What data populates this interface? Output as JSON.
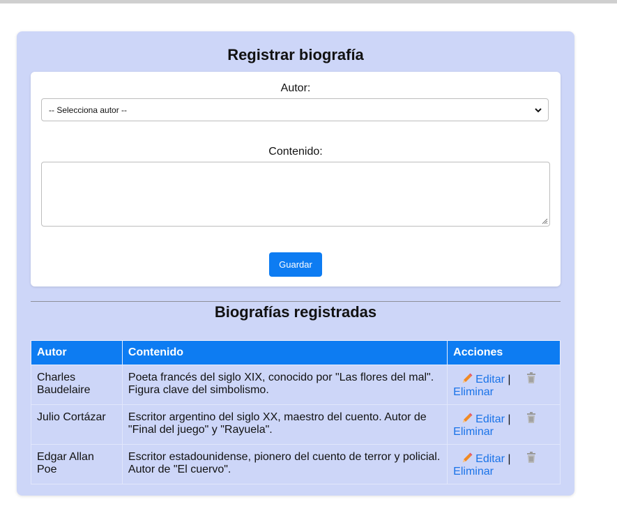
{
  "form": {
    "title": "Registrar biografía",
    "author_label": "Autor:",
    "author_select_value": "-- Selecciona autor --",
    "content_label": "Contenido:",
    "content_value": "",
    "save_label": "Guardar"
  },
  "list": {
    "title": "Biografías registradas",
    "headers": [
      "Autor",
      "Contenido",
      "Acciones"
    ],
    "rows": [
      {
        "author": "Charles Baudelaire",
        "content": "Poeta francés del siglo XIX, conocido por \"Las flores del mal\". Figura clave del simbolismo.",
        "edit_label": "Editar",
        "separator": "|",
        "delete_label": "Eliminar"
      },
      {
        "author": "Julio Cortázar",
        "content": "Escritor argentino del siglo XX, maestro del cuento. Autor de \"Final del juego\" y \"Rayuela\".",
        "edit_label": "Editar",
        "separator": "|",
        "delete_label": "Eliminar"
      },
      {
        "author": "Edgar Allan Poe",
        "content": "Escritor estadounidense, pionero del cuento de terror y policial. Autor de \"El cuervo\".",
        "edit_label": "Editar",
        "separator": "|",
        "delete_label": "Eliminar"
      }
    ]
  },
  "colors": {
    "panel_bg": "#cdd6f8",
    "accent": "#0d7cf2",
    "link": "#1a73e8"
  },
  "icons": {
    "edit": "pencil-icon",
    "delete": "trash-icon"
  }
}
